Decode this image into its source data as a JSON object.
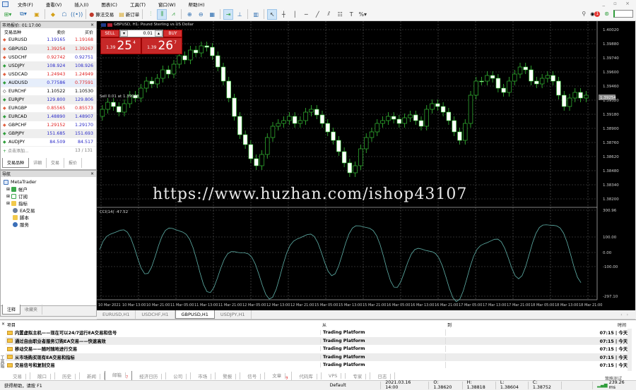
{
  "menu": [
    "文件(F)",
    "查看(V)",
    "插入(I)",
    "图表(C)",
    "工具(T)",
    "窗口(W)",
    "帮助(H)"
  ],
  "window_controls": "_ ▫ ×",
  "toolbar": {
    "algo_trading": "算法交易",
    "new_order": "新订单",
    "notification_count": "1"
  },
  "market_watch": {
    "title": "市场报价: 01:17:00",
    "columns": [
      "交易品种",
      "卖价",
      "买价"
    ],
    "rows": [
      {
        "symbol": "EURUSD",
        "dir": "dn",
        "bid": "1.19165",
        "ask": "1.19168",
        "bidc": "blue",
        "askc": "red"
      },
      {
        "symbol": "GBPUSD",
        "dir": "dn",
        "bid": "1.39254",
        "ask": "1.39267",
        "bidc": "red",
        "askc": "red"
      },
      {
        "symbol": "USDCHF",
        "dir": "dn",
        "bid": "0.92742",
        "ask": "0.92751",
        "bidc": "red",
        "askc": "blue"
      },
      {
        "symbol": "USDJPY",
        "dir": "up",
        "bid": "108.924",
        "ask": "108.926",
        "bidc": "blue",
        "askc": "blue"
      },
      {
        "symbol": "USDCAD",
        "dir": "dn",
        "bid": "1.24943",
        "ask": "1.24949",
        "bidc": "red",
        "askc": "red"
      },
      {
        "symbol": "AUDUSD",
        "dir": "up",
        "bid": "0.77586",
        "ask": "0.77591",
        "bidc": "blue",
        "askc": "red"
      },
      {
        "symbol": "EURCHF",
        "dir": "nt",
        "bid": "1.10522",
        "ask": "1.10530",
        "bidc": "black",
        "askc": "black"
      },
      {
        "symbol": "EURJPY",
        "dir": "up",
        "bid": "129.800",
        "ask": "129.806",
        "bidc": "blue",
        "askc": "blue"
      },
      {
        "symbol": "EURGBP",
        "dir": "dn",
        "bid": "0.85565",
        "ask": "0.85573",
        "bidc": "red",
        "askc": "red"
      },
      {
        "symbol": "EURCAD",
        "dir": "up",
        "bid": "1.48890",
        "ask": "1.48907",
        "bidc": "blue",
        "askc": "blue"
      },
      {
        "symbol": "GBPCHF",
        "dir": "dn",
        "bid": "1.29152",
        "ask": "1.29170",
        "bidc": "red",
        "askc": "blue"
      },
      {
        "symbol": "GBPJPY",
        "dir": "up",
        "bid": "151.685",
        "ask": "151.693",
        "bidc": "blue",
        "askc": "blue"
      },
      {
        "symbol": "AUDJPY",
        "dir": "up",
        "bid": "84.509",
        "ask": "84.517",
        "bidc": "blue",
        "askc": "blue"
      }
    ],
    "add_label": "点击添加...",
    "count": "13 / 131",
    "tabs": [
      "交易品种",
      "详细",
      "交易",
      "报价"
    ]
  },
  "navigator": {
    "title": "导航",
    "root": "MetaTrader",
    "items": [
      "帐户",
      "订阅",
      "指标",
      "EA交易",
      "脚本",
      "服务"
    ],
    "tabs": [
      "注释",
      "收藏夹"
    ]
  },
  "chart": {
    "subtitle": "GBPUSD, H1:  Pound Sterling vs US Dollar",
    "sell_label": "SELL",
    "buy_label": "BUY",
    "lot": "0.01",
    "sell_prefix": "1.39",
    "sell_big": "25",
    "sell_sup": "4",
    "buy_prefix": "1.39",
    "buy_big": "26",
    "buy_sup": "7",
    "sell_line_label": "Sell 0.01 at 1.39063",
    "indicator_label": "CCI(14) -47.52",
    "price_axis": [
      "1.40020",
      "1.39880",
      "1.39740",
      "1.39600",
      "1.39460",
      "1.39320",
      "1.39180",
      "1.38900",
      "1.38760",
      "1.38620",
      "1.38480",
      "1.38340",
      "1.38200"
    ],
    "current_price": "1.39254",
    "cci_axis": [
      "300.96",
      "100.00",
      "0.00",
      "-100.00",
      "-297.10"
    ],
    "time_axis": [
      "10 Mar 2021",
      "10 Mar 13:00",
      "10 Mar 21:00",
      "11 Mar 05:00",
      "11 Mar 13:00",
      "11 Mar 21:00",
      "12 Mar 05:00",
      "12 Mar 13:00",
      "12 Mar 21:00",
      "15 Mar 05:00",
      "15 Mar 13:00",
      "15 Mar 21:00",
      "16 Mar 05:00",
      "16 Mar 13:00",
      "16 Mar 21:00",
      "17 Mar 05:00",
      "17 Mar 13:00",
      "17 Mar 21:00",
      "18 Mar 05:00",
      "18 Mar 13:00",
      "18 Mar 21:00"
    ],
    "watermark": "https://www.huzhan.com/ishop43107",
    "colors": {
      "bull": "#3ddc3d",
      "bear": "#ffffff",
      "grid": "#5a5a5a",
      "cci": "#5fb0a8"
    }
  },
  "chart_tabs": [
    "EURUSD,H1",
    "USDCHF,H1",
    "GBPUSD,H1",
    "USDJPY,H1"
  ],
  "active_chart_tab": 2,
  "toolbox": {
    "columns": [
      "项目",
      "从",
      "到",
      "时间"
    ],
    "rows": [
      {
        "subject": "内置虚拟主机——现在可以24/7运行EA交易和信号",
        "from": "Trading Platform",
        "to": "",
        "time": "07:15 | 今天"
      },
      {
        "subject": "通过自由职业者服务订购EA交易——快速高效",
        "from": "Trading Platform",
        "to": "",
        "time": "07:15 | 今天"
      },
      {
        "subject": "移动交易——随时随地进行交易",
        "from": "Trading Platform",
        "to": "",
        "time": "07:15 | 今天"
      },
      {
        "subject": "从市场购买现有EA交易和指标",
        "from": "Trading Platform",
        "to": "",
        "time": "07:15 | 今天"
      },
      {
        "subject": "交易信号和复制交易",
        "from": "Trading Platform",
        "to": "",
        "time": "07:15 | 今天"
      }
    ],
    "tabs": [
      {
        "label": "交易"
      },
      {
        "label": "敞口"
      },
      {
        "label": "历史"
      },
      {
        "label": "新闻"
      },
      {
        "label": "邮箱",
        "count": "7"
      },
      {
        "label": "经济日历"
      },
      {
        "label": "公司"
      },
      {
        "label": "市场"
      },
      {
        "label": "警报"
      },
      {
        "label": "信号"
      },
      {
        "label": "文章",
        "count": "9"
      },
      {
        "label": "代码库"
      },
      {
        "label": "VPS"
      },
      {
        "label": "专家"
      },
      {
        "label": "日志"
      }
    ],
    "active_tab": 4,
    "side_label": "工具箱",
    "strategy_tester": "策略测试"
  },
  "status": {
    "help": "获得帮助，请按 F1",
    "profile": "Default",
    "datetime": "2021.03.16 14:00",
    "open": "O: 1.38620",
    "high": "H: 1.38818",
    "low": "L: 1.38604",
    "close": "C: 1.38752",
    "ping": "239.26 ms"
  }
}
